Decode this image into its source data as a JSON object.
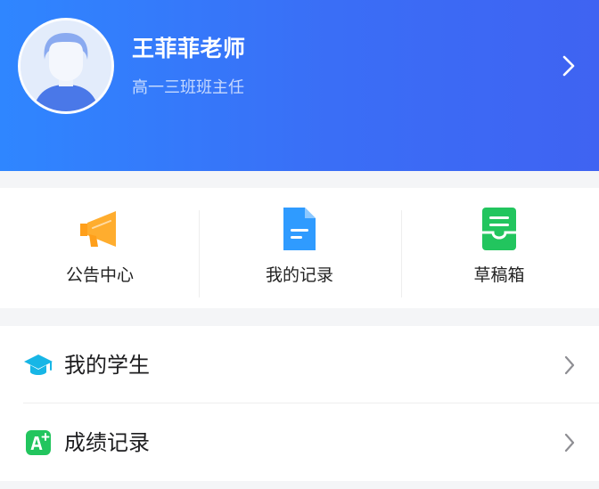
{
  "profile": {
    "name": "王菲菲老师",
    "role": "高一三班班主任",
    "avatar_icon": "teacher-avatar-icon",
    "arrow_icon": "chevron-right-icon"
  },
  "quick_actions": [
    {
      "label": "公告中心",
      "icon": "megaphone-icon",
      "color": "#ff9f1a"
    },
    {
      "label": "我的记录",
      "icon": "document-icon",
      "color": "#2f9bff"
    },
    {
      "label": "草稿箱",
      "icon": "drafts-tray-icon",
      "color": "#22c55e"
    }
  ],
  "menu": [
    {
      "label": "我的学生",
      "icon": "graduation-cap-icon",
      "color": "#17b6e6"
    },
    {
      "label": "成绩记录",
      "icon": "grade-a-plus-icon",
      "color": "#22c55e"
    }
  ],
  "colors": {
    "header_gradient_start": "#2f86ff",
    "header_gradient_end": "#3f63f2",
    "page_background": "#f4f5f7"
  }
}
